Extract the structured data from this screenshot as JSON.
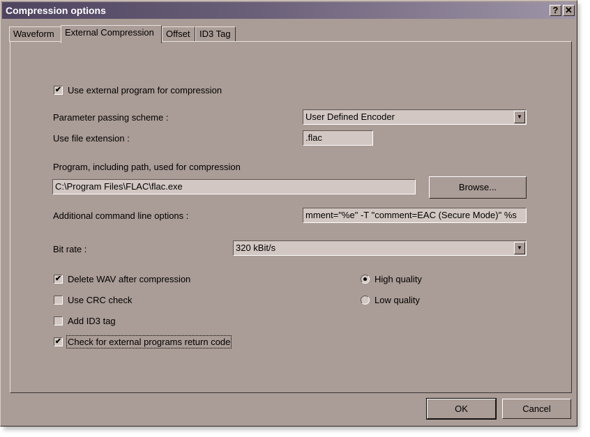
{
  "window": {
    "title": "Compression options",
    "help_label": "?",
    "close_label": "✕"
  },
  "tabs": [
    {
      "label": "Waveform",
      "active": false
    },
    {
      "label": "External Compression",
      "active": true
    },
    {
      "label": "Offset",
      "active": false
    },
    {
      "label": "ID3 Tag",
      "active": false
    }
  ],
  "form": {
    "use_external": {
      "label": "Use external program for compression",
      "checked": true
    },
    "param_scheme": {
      "label": "Parameter passing scheme :",
      "value": "User Defined Encoder"
    },
    "file_ext": {
      "label": "Use file extension :",
      "value": ".flac"
    },
    "program": {
      "label": "Program, including path, used for compression",
      "value": "C:\\Program Files\\FLAC\\flac.exe",
      "browse_label": "Browse..."
    },
    "cmd_options": {
      "label": "Additional command line options :",
      "value": "mment=\"%e\" -T \"comment=EAC (Secure Mode)\" %s"
    },
    "bitrate": {
      "label": "Bit rate :",
      "value": "320 kBit/s"
    },
    "delete_wav": {
      "label": "Delete WAV after compression",
      "checked": true
    },
    "crc": {
      "label": "Use CRC check",
      "checked": false
    },
    "id3": {
      "label": "Add ID3 tag",
      "checked": false
    },
    "return_code": {
      "label": "Check for external programs return code",
      "checked": true
    },
    "quality": [
      {
        "label": "High quality",
        "selected": true
      },
      {
        "label": "Low quality",
        "selected": false
      }
    ]
  },
  "footer": {
    "ok_label": "OK",
    "cancel_label": "Cancel"
  },
  "icons": {
    "check": "✔",
    "dropdown": "▼"
  }
}
